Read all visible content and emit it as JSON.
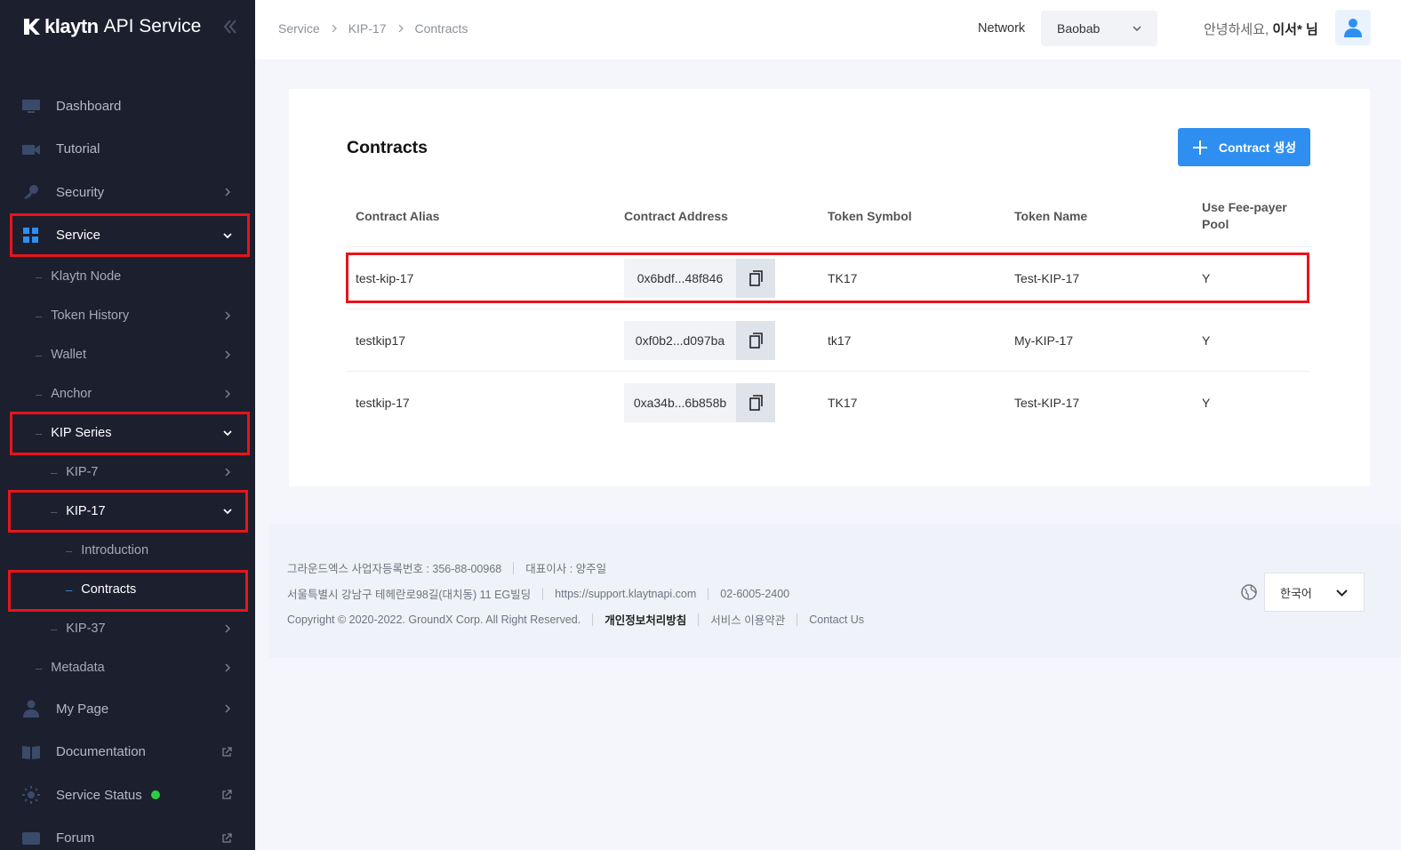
{
  "sidebar": {
    "brand": "klaytn",
    "brand_sub": "API Service",
    "items": {
      "dashboard": "Dashboard",
      "tutorial": "Tutorial",
      "security": "Security",
      "service": "Service",
      "klaytn_node": "Klaytn Node",
      "token_history": "Token History",
      "wallet": "Wallet",
      "anchor": "Anchor",
      "kip_series": "KIP Series",
      "kip7": "KIP-7",
      "kip17": "KIP-17",
      "introduction": "Introduction",
      "contracts": "Contracts",
      "kip37": "KIP-37",
      "metadata": "Metadata",
      "my_page": "My Page",
      "documentation": "Documentation",
      "service_status": "Service Status",
      "forum": "Forum"
    },
    "status_color": "#2ecc40"
  },
  "header": {
    "breadcrumb": [
      "Service",
      "KIP-17",
      "Contracts"
    ],
    "network_label": "Network",
    "network_value": "Baobab",
    "greeting": "안녕하세요,",
    "user_name": "이서* 님"
  },
  "main": {
    "title": "Contracts",
    "create_button": "Contract 생성",
    "columns": {
      "alias": "Contract Alias",
      "address": "Contract Address",
      "symbol": "Token Symbol",
      "name": "Token Name",
      "fee_payer_1": "Use Fee-payer",
      "fee_payer_2": "Pool"
    },
    "rows": [
      {
        "alias": "test-kip-17",
        "address": "0x6bdf...48f846",
        "symbol": "TK17",
        "name": "Test-KIP-17",
        "fee": "Y"
      },
      {
        "alias": "testkip17",
        "address": "0xf0b2...d097ba",
        "symbol": "tk17",
        "name": "My-KIP-17",
        "fee": "Y"
      },
      {
        "alias": "testkip-17",
        "address": "0xa34b...6b858b",
        "symbol": "TK17",
        "name": "Test-KIP-17",
        "fee": "Y"
      }
    ]
  },
  "footer": {
    "company": "그라운드엑스 사업자등록번호 : 356-88-00968",
    "ceo": "대표이사 : 양주일",
    "address": "서울특별시 강남구 테헤란로98길(대치동) 11 EG빌딩",
    "support_url": "https://support.klaytnapi.com",
    "phone": "02-6005-2400",
    "copyright": "Copyright © 2020-2022. GroundX Corp. All Right Reserved.",
    "privacy": "개인정보처리방침",
    "terms": "서비스 이용약관",
    "contact": "Contact Us",
    "language": "한국어"
  },
  "colors": {
    "accent": "#2e8ff0",
    "highlight": "#e8141b",
    "sidebar_bg": "#1c1f2e"
  }
}
